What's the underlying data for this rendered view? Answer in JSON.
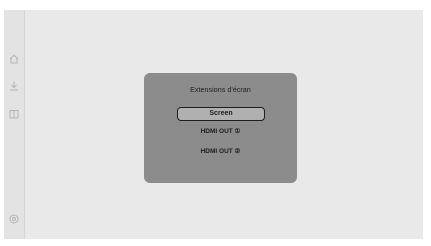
{
  "sidebar": {
    "icons": [
      "home-icon",
      "download-icon",
      "book-icon",
      "settings-icon"
    ]
  },
  "dialog": {
    "title": "Extensions d'écran",
    "options": [
      {
        "label": "Screen",
        "selected": true
      },
      {
        "label": "HDMI OUT ①",
        "selected": false
      },
      {
        "label": "HDMI OUT ②",
        "selected": false
      }
    ]
  },
  "colors": {
    "background": "#e9e9e9",
    "sidebar": "#e3e3e3",
    "dialog": "#8c8c8c",
    "selected_option": "#b0b0b0",
    "text": "#1c1c1c"
  }
}
